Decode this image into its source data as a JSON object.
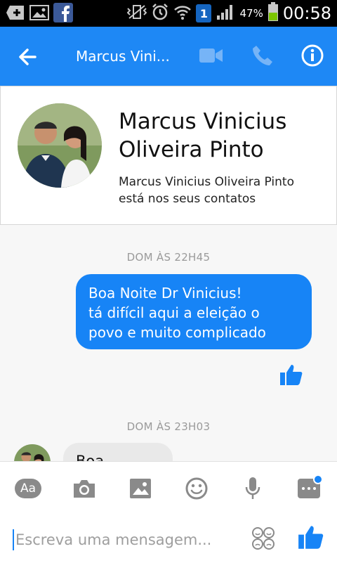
{
  "status_bar": {
    "icons": [
      "add-icon",
      "gallery-icon",
      "facebook-icon",
      "vibrate-icon",
      "alarm-icon",
      "wifi-icon",
      "sim-icon",
      "signal-icon",
      "battery-icon"
    ],
    "sim_number": "1",
    "battery": "47%",
    "time": "00:58"
  },
  "header": {
    "title": "Marcus Vini..."
  },
  "contact": {
    "name": "Marcus Vinicius Oliveira Pinto",
    "name_line1": "Marcus Vinicius",
    "name_line2": "Oliveira Pinto",
    "subtitle_line1": "Marcus Vinicius Oliveira Pinto",
    "subtitle_line2": "está nos seus contatos"
  },
  "messages": {
    "timestamp1": "DOM ÀS 22H45",
    "out_lines": [
      "Boa Noite Dr Vinicius!",
      "tá difícil aqui a eleição o",
      "povo e muito complicado"
    ],
    "timestamp2": "DOM ÀS 23H03",
    "in_text": "Boa noite!!!"
  },
  "composer": {
    "aa_label": "Aa",
    "placeholder": "Escreva uma mensagem..."
  },
  "colors": {
    "accent": "#1784f6",
    "header": "#1e88f5"
  }
}
